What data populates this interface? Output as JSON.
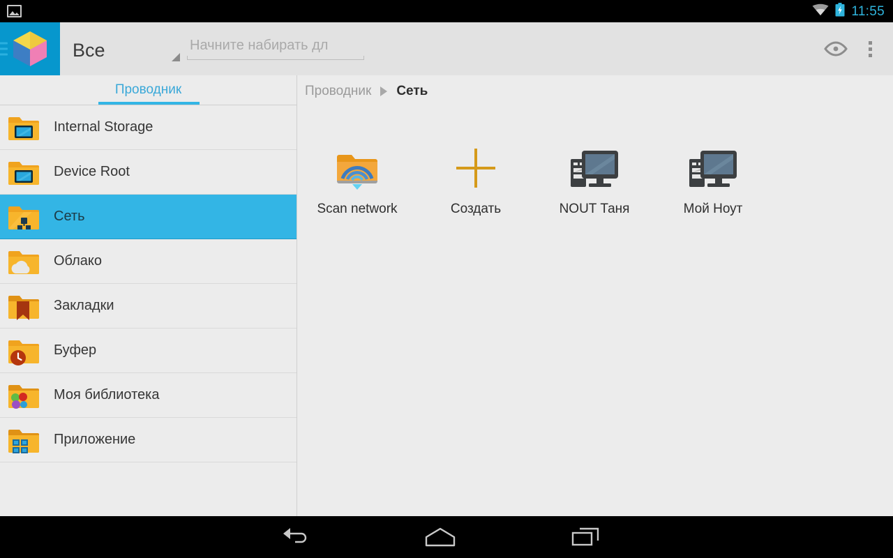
{
  "status_bar": {
    "notification_icon": "photo-icon",
    "wifi_icon": "wifi-icon",
    "battery_icon": "battery-charging-icon",
    "clock": "11:55",
    "accent_color": "#2fb4dd",
    "background": "#000000"
  },
  "toolbar": {
    "app_icon": "cube-logo-icon",
    "drawer_icon": "hamburger-icon",
    "app_tile_color": "#0797cd",
    "spinner_label": "Все",
    "spinner_caret_icon": "dropdown-triangle-icon",
    "search_placeholder": "Начните набирать дл",
    "search_value": "",
    "preview_icon": "eye-icon",
    "overflow_icon": "kebab-menu-icon",
    "background": "#e2e2e2"
  },
  "sidebar": {
    "tab_label": "Проводник",
    "tab_accent": "#33b5e5",
    "selected_index": 2,
    "items": [
      {
        "label": "Internal Storage",
        "icon": "folder-device-icon"
      },
      {
        "label": "Device Root",
        "icon": "folder-device-icon"
      },
      {
        "label": "Сеть",
        "icon": "folder-network-icon"
      },
      {
        "label": "Облако",
        "icon": "folder-cloud-icon"
      },
      {
        "label": "Закладки",
        "icon": "folder-bookmark-icon"
      },
      {
        "label": "Буфер",
        "icon": "folder-clock-icon"
      },
      {
        "label": "Моя библиотека",
        "icon": "folder-library-icon"
      },
      {
        "label": "Приложение",
        "icon": "folder-apps-icon"
      }
    ]
  },
  "main": {
    "breadcrumb": {
      "root": "Проводник",
      "separator_icon": "breadcrumb-arrow-icon",
      "current": "Сеть"
    },
    "items": [
      {
        "label": "Scan network",
        "icon": "folder-wifi-scan-icon"
      },
      {
        "label": "Создать",
        "icon": "plus-icon"
      },
      {
        "label": "NOUT Таня",
        "icon": "computer-icon"
      },
      {
        "label": "Мой Ноут",
        "icon": "computer-icon"
      }
    ]
  },
  "nav_bar": {
    "back_label": "back-icon",
    "home_label": "home-icon",
    "recents_label": "recents-icon",
    "background": "#000000"
  }
}
